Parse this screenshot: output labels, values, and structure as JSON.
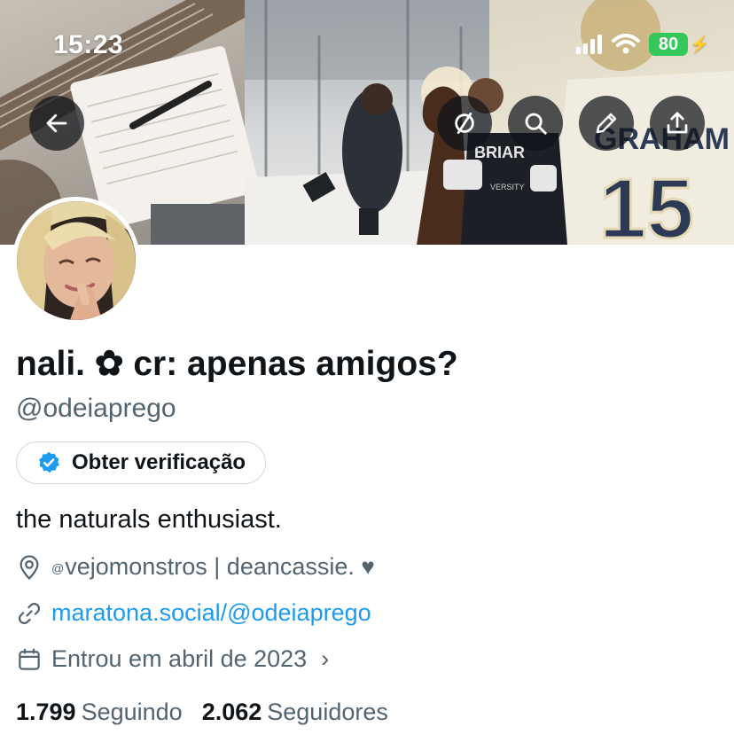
{
  "status_bar": {
    "time": "15:23",
    "battery": "80",
    "icons": [
      "signal-icon",
      "wifi-icon",
      "battery-icon",
      "charging-bolt-icon"
    ]
  },
  "header_buttons": {
    "back": "arrow-left-icon",
    "filter": "filter-circle-icon",
    "search": "search-icon",
    "edit": "pencil-icon",
    "share": "share-upload-icon"
  },
  "banner": {
    "jersey_text": "BRIAR",
    "jersey_sub": "VERSITY",
    "back_jersey_name": "GRAHAM",
    "back_jersey_number": "15"
  },
  "profile": {
    "display_name": "nali. ✿ cr: apenas amigos?",
    "handle": "@odeiaprego",
    "verify_button": "Obter verificação",
    "bio": "the naturals enthusiast.",
    "location_at": "@",
    "location": "vejomonstros | deancassie.",
    "location_heart": "♥",
    "link": "maratona.social/@odeiaprego",
    "joined": "Entrou em abril de 2023",
    "joined_chevron": "›"
  },
  "stats": {
    "following_count": "1.799",
    "following_label": "Seguindo",
    "followers_count": "2.062",
    "followers_label": "Seguidores"
  },
  "colors": {
    "accent": "#1d9bf0",
    "muted": "#536471",
    "text": "#0f1419",
    "battery": "#34c759"
  }
}
